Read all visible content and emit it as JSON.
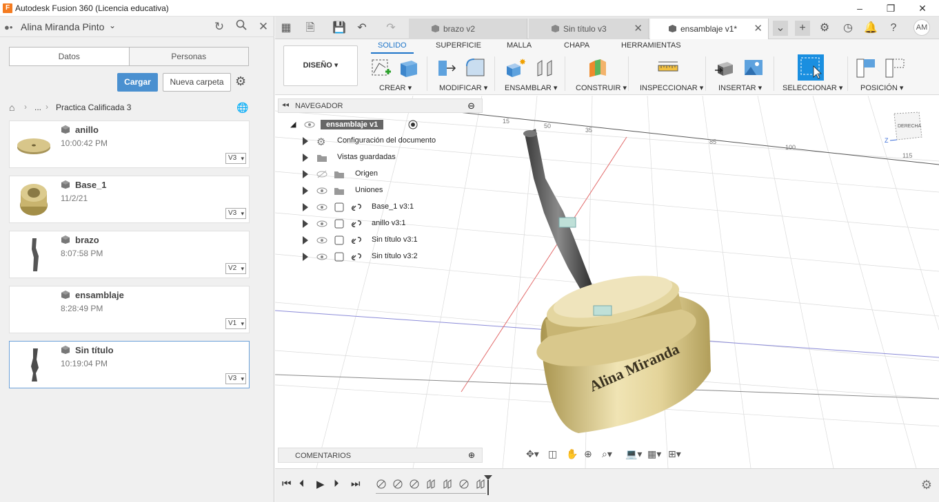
{
  "window": {
    "title": "Autodesk Fusion 360 (Licencia educativa)",
    "app_icon": "F"
  },
  "data_panel": {
    "user_name": "Alina Miranda Pinto",
    "tabs": [
      "Datos",
      "Personas"
    ],
    "upload_button": "Cargar",
    "new_folder_button": "Nueva carpeta",
    "breadcrumb": {
      "ellipsis": "...",
      "folder": "Practica Calificada 3"
    },
    "files": [
      {
        "name": "anillo",
        "date": "10:00:42 PM",
        "version": "V3"
      },
      {
        "name": "Base_1",
        "date": "11/2/21",
        "version": "V3"
      },
      {
        "name": "brazo",
        "date": "8:07:58 PM",
        "version": "V2"
      },
      {
        "name": "ensamblaje",
        "date": "8:28:49 PM",
        "version": "V1"
      },
      {
        "name": "Sin título",
        "date": "10:19:04 PM",
        "version": "V3"
      }
    ]
  },
  "doc_tabs": [
    {
      "label": "brazo v2",
      "active": false
    },
    {
      "label": "Sin título v3",
      "active": false
    },
    {
      "label": "ensamblaje v1*",
      "active": true
    }
  ],
  "user_initials": "AM",
  "toolbar": {
    "workspace": "DISEÑO",
    "workspace_tabs": [
      "SOLIDO",
      "SUPERFICIE",
      "MALLA",
      "CHAPA",
      "HERRAMIENTAS"
    ],
    "groups": [
      "CREAR",
      "MODIFICAR",
      "ENSAMBLAR",
      "CONSTRUIR",
      "INSPECCIONAR",
      "INSERTAR",
      "SELECCIONAR",
      "POSICIÓN"
    ]
  },
  "browser": {
    "title": "NAVEGADOR",
    "root": "ensamblaje v1",
    "items": [
      "Configuración del documento",
      "Vistas guardadas",
      "Origen",
      "Uniones",
      "Base_1 v3:1",
      "anillo v3:1",
      "Sin título v3:1",
      "Sin título v3:2"
    ]
  },
  "comments_label": "COMENTARIOS",
  "viewcube_label": "DERECHA",
  "viewcube_axis": "Z",
  "model_text": "Alina Miranda",
  "ruler_ticks": [
    "15",
    "50",
    "35",
    "85",
    "100",
    "115"
  ],
  "colors": {
    "accent": "#1a73c8",
    "upload": "#4a90d0",
    "gold": "#cdb876"
  }
}
